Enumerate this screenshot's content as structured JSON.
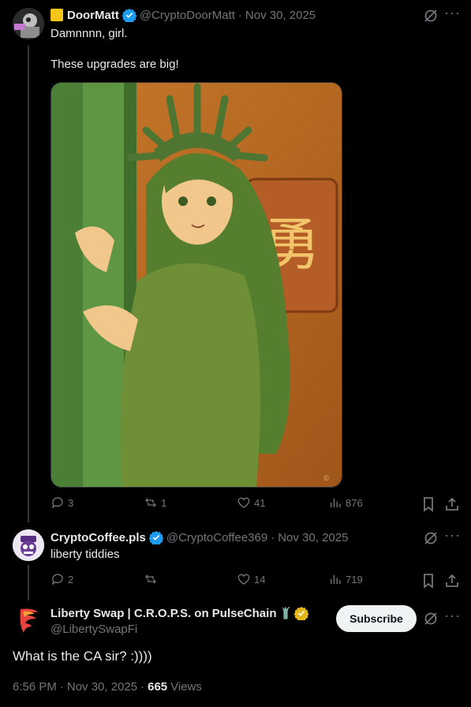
{
  "post1": {
    "name_prefix_icon": "yellow-square-emoji",
    "display_name": "DoorMatt",
    "handle": "@CryptoDoorMatt",
    "separator": "·",
    "date": "Nov 30, 2025",
    "text_line1": "Damnnnn, girl.",
    "text_line2": "These upgrades are big!",
    "image_glyph": "勇",
    "image_watermark": "©",
    "stats": {
      "replies": "3",
      "reposts": "1",
      "likes": "41",
      "views": "876"
    }
  },
  "post2": {
    "display_name": "CryptoCoffee.pls",
    "handle": "@CryptoCoffee369",
    "separator": "·",
    "date": "Nov 30, 2025",
    "text": "liberty tiddies",
    "stats": {
      "replies": "2",
      "reposts": "",
      "likes": "14",
      "views": "719"
    }
  },
  "main_post": {
    "display_name": "Liberty Swap | C.R.O.P.S. on PulseChain",
    "name_suffix_icon": "statue-of-liberty-emoji",
    "handle": "@LibertySwapFi",
    "subscribe_label": "Subscribe",
    "text": "What is the CA sir? :))))",
    "time": "6:56 PM",
    "separator": "·",
    "date": "Nov 30, 2025",
    "separator2": "·",
    "views_count": "665",
    "views_label": "Views"
  },
  "colors": {
    "background": "#000000",
    "text": "#e7e9ea",
    "muted": "#71767b",
    "verified_blue": "#1d9bf0",
    "verified_gold": "#e2b719",
    "thread_line": "#333639"
  }
}
